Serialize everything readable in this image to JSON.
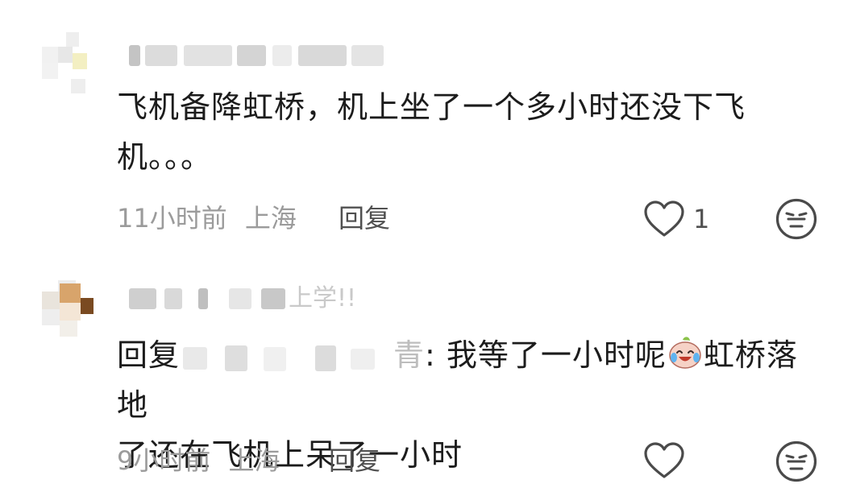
{
  "comments": [
    {
      "body": "飞机备降虹桥，机上坐了一个多小时还没下飞机。。。",
      "time": "11小时前",
      "location": "上海",
      "reply_label": "回复",
      "likes": "1",
      "like_icon": "heart-outline-icon",
      "dislike_icon": "neutral-face-icon"
    },
    {
      "name_visible_suffix": "上学!!",
      "reply_prefix": "回复",
      "reply_target_tail": "nbsp",
      "reply_tail_char": "青",
      "body_part1": ": 我等了一小时呢",
      "emoji": "crying-laughing-emoji",
      "body_part2": "虹桥落地了还在飞机上呆了一小时",
      "time": "9小时前",
      "location": "上海",
      "reply_label": "回复",
      "like_icon": "heart-outline-icon",
      "dislike_icon": "neutral-face-icon"
    }
  ],
  "colors": {
    "text": "#1c1c1c",
    "meta": "#9b9b9b",
    "action": "#505050",
    "blur": "#d8d8d8"
  }
}
